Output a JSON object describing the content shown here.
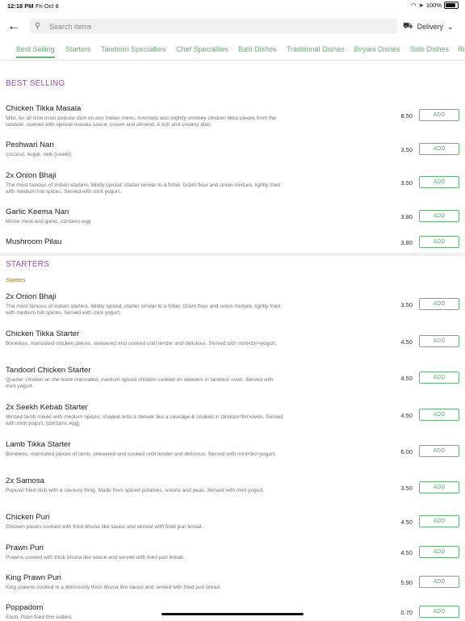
{
  "status": {
    "time": "12:18 PM",
    "date": "Fri Oct 8",
    "battery": "100%"
  },
  "search": {
    "placeholder": "Search items"
  },
  "delivery": {
    "label": "Delivery"
  },
  "tabs": [
    "Best Selling",
    "Starters",
    "Tandoori Specialties",
    "Chef Specialties",
    "Balti Dishes",
    "Traditional Dishes",
    "Biryani Dishes",
    "Side Dishes",
    "Ri"
  ],
  "add_label": "ADD",
  "sections": {
    "best": {
      "title": "BEST SELLING"
    },
    "starters": {
      "title": "STARTERS",
      "subtitle": "Starters"
    }
  },
  "items": [
    {
      "name": "Chicken Tikka Masala",
      "desc": "Mild, An all time most popular dish on any Indian menu. Aromatic and slightly smokey chicken tikka pieces from the tandoor, cooked with special masala sauce, cream and almond. A rich and creamy dish.",
      "price": "8.50"
    },
    {
      "name": "Peshwari Nan",
      "desc": "coconut, sugar, milk (sweet)",
      "price": "3.50"
    },
    {
      "name": "2x Onion Bhaji",
      "desc": "The most famous of Indian starters. Mildly spiced, starter similar to a fritter. Gram flour and onion mixture, lightly fried with medium hot spices. Served with mint yogurt.",
      "price": "3.50"
    },
    {
      "name": "Garlic Keema Nan",
      "desc": "Mince meat and garlic, contains egg",
      "price": "3.80"
    },
    {
      "name": "Mushroom Pilau",
      "desc": "",
      "price": "3.80"
    },
    {
      "name": "2x Onion Bhaji",
      "desc": "The most famous of Indian starters. Mildly spiced, starter similar to a fritter. Gram flour and onion mixture, lightly fried with medium hot spices. Served with mint yogurt.",
      "price": "3.50"
    },
    {
      "name": "Chicken Tikka Starter",
      "desc": "Boneless, marinated chicken pieces, skewered and cooked until tender and delicious. Served with mint<br/>yogurt.",
      "price": "4.50"
    },
    {
      "name": "Tandoori Chicken Starter",
      "desc": "Quarter chicken on the bone marinated, medium spiced chicken cooked on skewers in tandoori oven. Served with mint yogurt.",
      "price": "4.50"
    },
    {
      "name": "2x Seekh Kebab Starter",
      "desc": "Minced lamb mixed with medium spices, shaped onto a skewer like a sausage & cooked in tandoor<br/>oven. Served with mint yogurt. (contains egg)",
      "price": "4.50"
    },
    {
      "name": "Lamb Tikka Starter",
      "desc": "Boneless, marinated pieces of lamb, skewered and cooked until tender and delicious. Served with mint<br/>yogurt.",
      "price": "6.00"
    },
    {
      "name": "2x Samosa",
      "desc": "Popular fried dish with a savoury filing. Made from spiced potatoes, onions and peas. Served with mint yogurt.",
      "price": "3.50"
    },
    {
      "name": "Chicken Puri",
      "desc": "Chicken pieces cooked with thick bhuna like sauce and served with fried puri bread.",
      "price": "4.50"
    },
    {
      "name": "Prawn Puri",
      "desc": "Prawns cooked with thick bhuna like sauce and served with fried puri bread.",
      "price": "4.50"
    },
    {
      "name": "King Prawn Puri",
      "desc": "King prawns cooked in a deliciously thick bhuna like sauce and served with fried puri bread.",
      "price": "5.90"
    },
    {
      "name": "Poppadom",
      "desc": "Each. Plain fried thin wafers",
      "price": "0.70"
    }
  ],
  "colors": {
    "accent": "#61b870",
    "section": "#a64ab8"
  }
}
